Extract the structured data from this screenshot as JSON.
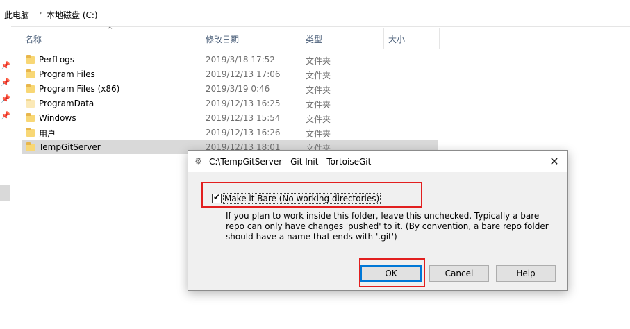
{
  "breadcrumb": {
    "root": "此电脑",
    "separator": "›",
    "current": "本地磁盘 (C:)"
  },
  "columns": {
    "name": "名称",
    "modified": "修改日期",
    "type": "类型",
    "size": "大小"
  },
  "files": [
    {
      "name": "PerfLogs",
      "date": "2019/3/18 17:52",
      "type": "文件夹"
    },
    {
      "name": "Program Files",
      "date": "2019/12/13 17:06",
      "type": "文件夹"
    },
    {
      "name": "Program Files (x86)",
      "date": "2019/3/19 0:46",
      "type": "文件夹"
    },
    {
      "name": "ProgramData",
      "date": "2019/12/13 16:25",
      "type": "文件夹"
    },
    {
      "name": "Windows",
      "date": "2019/12/13 15:54",
      "type": "文件夹"
    },
    {
      "name": "用户",
      "date": "2019/12/13 16:26",
      "type": "文件夹"
    },
    {
      "name": "TempGitServer",
      "date": "2019/12/13 18:01",
      "type": "文件夹"
    }
  ],
  "dialog": {
    "title": "C:\\TempGitServer - Git Init - TortoiseGit",
    "close_glyph": "✕",
    "checkbox_label": "Make it Bare (No working directories)",
    "checkbox_checked": true,
    "description": "If you plan to work inside this folder, leave this unchecked. Typically a bare repo can only have changes 'pushed' to it. (By convention, a bare repo folder should have a name that ends with '.git')",
    "buttons": {
      "ok": "OK",
      "cancel": "Cancel",
      "help": "Help"
    }
  },
  "colors": {
    "highlight_box": "#e21f1f",
    "selected_row": "#d9d9d9",
    "folder": "#f8d775",
    "dialog_bg": "#f0f0f0"
  },
  "icons": {
    "pin": "pin-icon",
    "folder": "folder-icon",
    "tortoisegit": "tortoisegit-icon",
    "close": "close-icon",
    "checkbox": "checkmark-icon",
    "sort": "sort-up-icon"
  }
}
